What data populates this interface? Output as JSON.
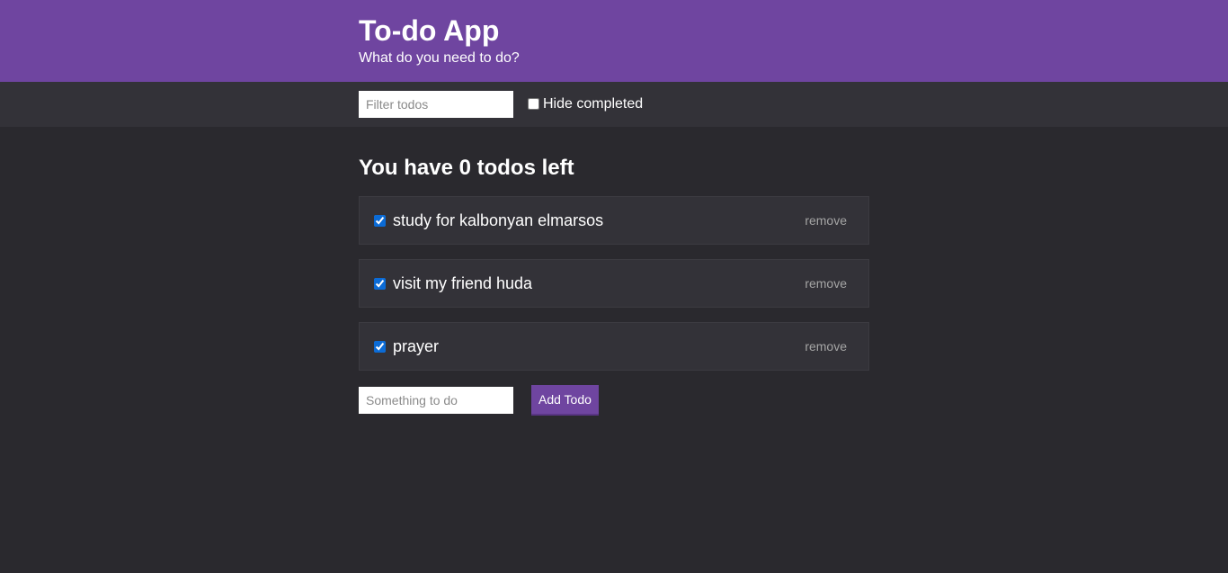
{
  "header": {
    "title": "To-do App",
    "subtitle": "What do you need to do?"
  },
  "filter": {
    "placeholder": "Filter todos",
    "value": "",
    "hide_completed_label": "Hide completed",
    "hide_completed_checked": false
  },
  "summary": "You have 0 todos left",
  "todos": [
    {
      "text": "study for kalbonyan elmarsos",
      "completed": true,
      "remove_label": "remove"
    },
    {
      "text": "visit my friend huda",
      "completed": true,
      "remove_label": "remove"
    },
    {
      "text": "prayer",
      "completed": true,
      "remove_label": "remove"
    }
  ],
  "add_form": {
    "placeholder": "Something to do",
    "value": "",
    "button_label": "Add Todo"
  },
  "colors": {
    "accent": "#6f45a0",
    "background": "#2a292e",
    "bar": "#333238"
  }
}
